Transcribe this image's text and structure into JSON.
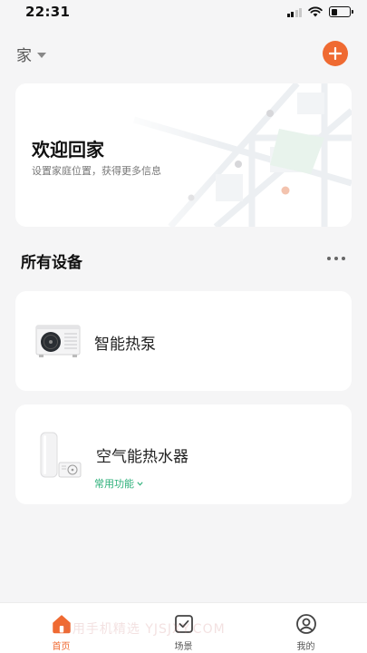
{
  "status_bar": {
    "time": "22:31",
    "battery_level": 0.35
  },
  "header": {
    "home_name": "家",
    "add_icon": "plus-circle-icon",
    "accent_color": "#ef6a32"
  },
  "welcome_card": {
    "title": "欢迎回家",
    "subtitle": "设置家庭位置，获得更多信息"
  },
  "devices_section": {
    "title": "所有设备",
    "more_icon": "more-dots-icon"
  },
  "devices": [
    {
      "name": "智能热泵",
      "icon": "heat-pump-icon"
    },
    {
      "name": "空气能热水器",
      "icon": "water-heater-icon",
      "link": "常用功能",
      "link_color": "#2db07a"
    }
  ],
  "tab_bar": {
    "tabs": [
      {
        "label": "首页",
        "icon": "home-icon",
        "active": true
      },
      {
        "label": "场景",
        "icon": "scene-checkbox-icon",
        "active": false
      },
      {
        "label": "我的",
        "icon": "profile-icon",
        "active": false
      }
    ]
  },
  "watermark": "6用手机精选 YJSJXY.COM"
}
